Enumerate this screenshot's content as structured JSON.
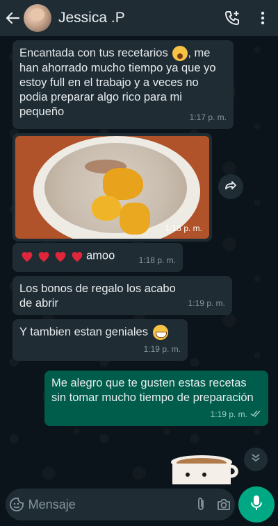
{
  "header": {
    "contact_name": "Jessica .P"
  },
  "messages": [
    {
      "text": "Encantada con tus recetarios",
      "text2": ", me han ahorrado mucho tiempo ya que yo estoy full en el trabajo y a veces no podia preparar algo rico para mi pequeño",
      "time": "1:17 p. m."
    },
    {
      "time": "1:18 p. m."
    },
    {
      "text": "amoo",
      "time": "1:18 p. m."
    },
    {
      "text": "Los bonos de regalo los acabo de abrir",
      "time": "1:19 p. m."
    },
    {
      "text": "Y tambien estan geniales",
      "time": "1:19 p. m."
    },
    {
      "text": "Me alegro que te gusten estas recetas sin tomar mucho tiempo de preparación",
      "time": "1:19 p. m."
    }
  ],
  "composer": {
    "placeholder": "Mensaje"
  },
  "colors": {
    "header_bg": "#1f2c34",
    "incoming_bubble": "#1f2c34",
    "outgoing_bubble": "#005c4b",
    "accent": "#00a884"
  }
}
